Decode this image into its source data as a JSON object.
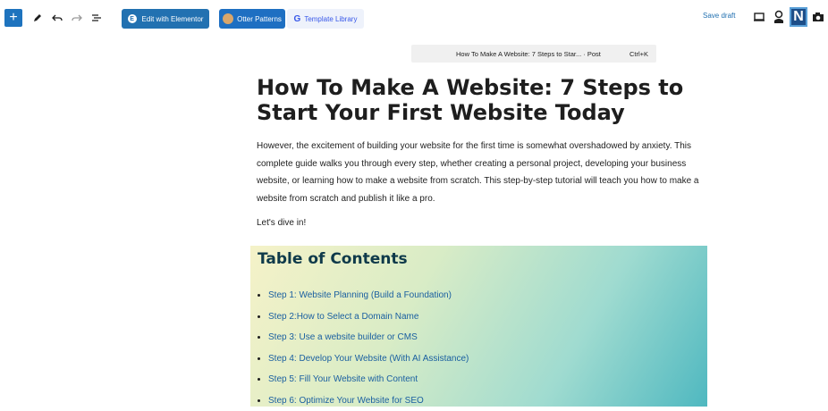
{
  "toolbar": {
    "add_label": "+",
    "elementor_label": "Edit with Elementor",
    "otter_label": "Otter Patterns",
    "template_label": "Template Library",
    "save_draft_label": "Save draft",
    "n_label": "N"
  },
  "command_bar": {
    "title": "How To Make A Website: 7 Steps to Star... · Post",
    "shortcut": "Ctrl+K"
  },
  "post": {
    "title": "How To Make A Website: 7 Steps to Start Your First Website Today",
    "paragraph": "However, the excitement of building your website for the first time is somewhat overshadowed by anxiety. This complete guide walks you through every step, whether creating a personal project, developing your business website, or learning how to make a website from scratch. This step-by-step tutorial will teach you how to make a website from scratch and publish it like a pro.",
    "dive_in": "Let's dive in!"
  },
  "toc": {
    "title": "Table of Contents",
    "items": [
      "Step 1: Website Planning (Build a Foundation)",
      "Step 2:How to Select a Domain Name",
      "Step 3: Use a website builder or CMS",
      "Step 4: Develop Your Website (With AI Assistance)",
      "Step 5: Fill Your Website with Content",
      "Step 6: Optimize Your Website for SEO"
    ]
  }
}
